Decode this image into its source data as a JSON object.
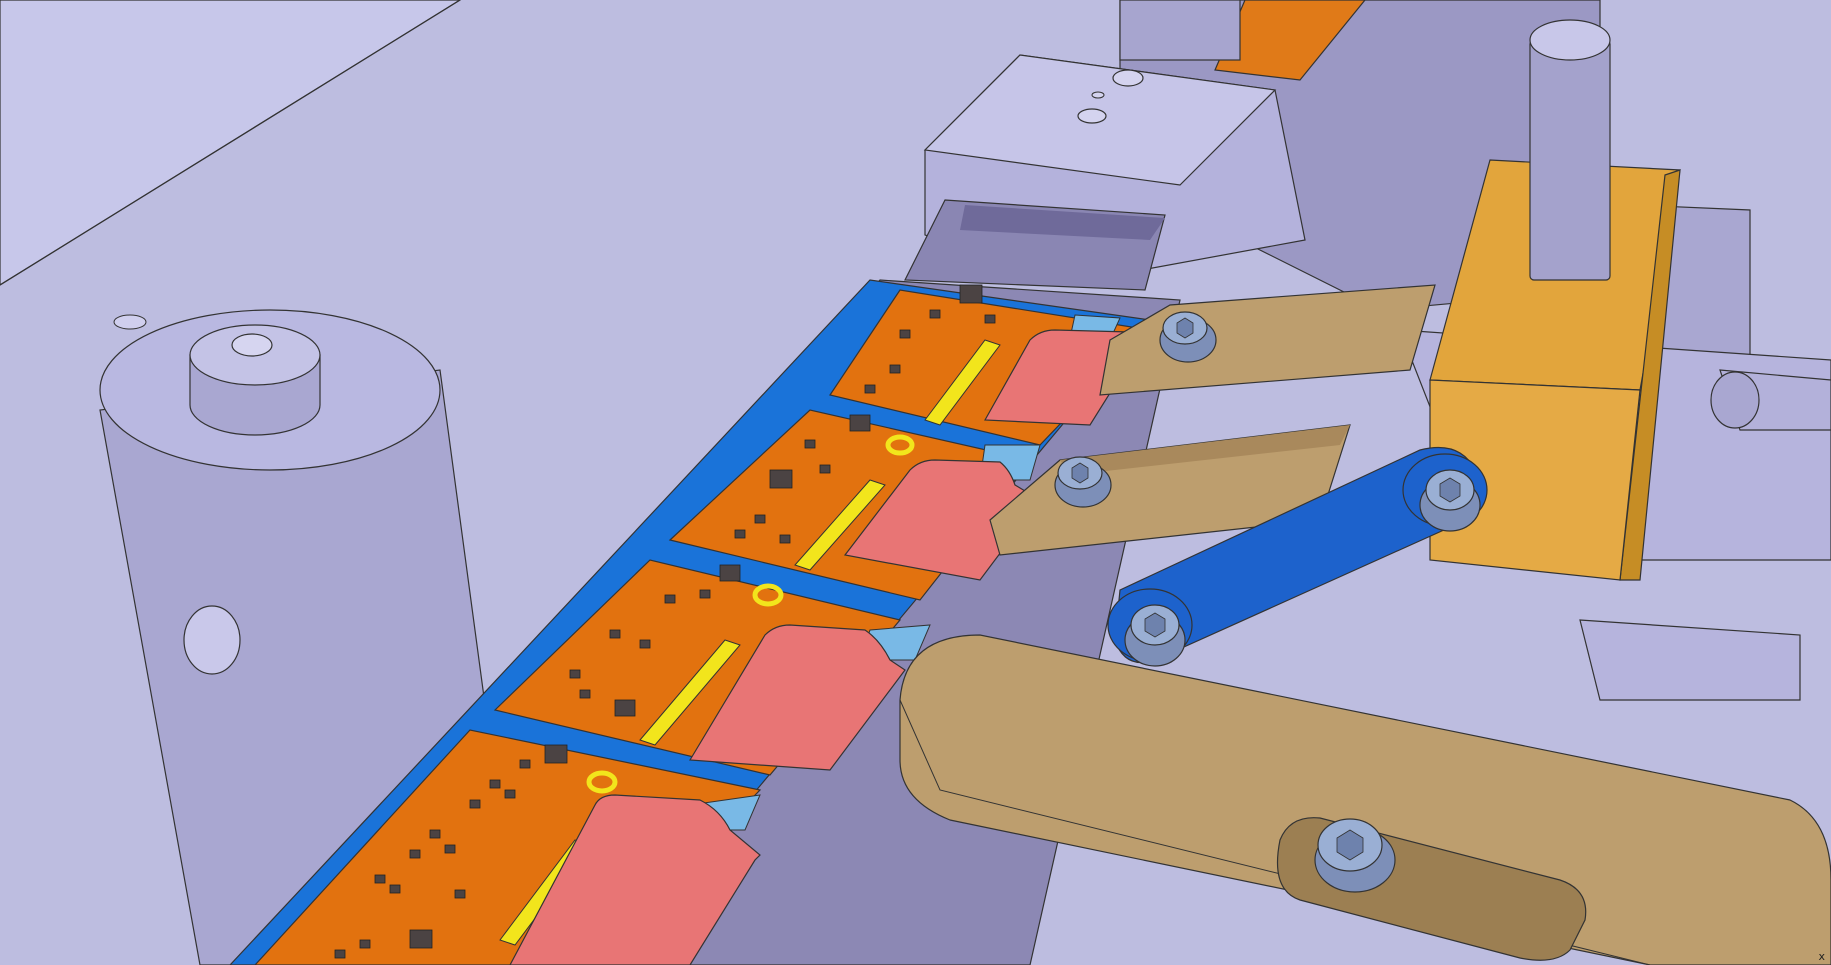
{
  "view": {
    "corner_label": "x",
    "colors": {
      "background": "#bdbde0",
      "base_plate": "#b9b9e1",
      "fixture_metal": "#a6a6cf",
      "fixture_dark": "#8e8ab4",
      "pcb_orange": "#e2720f",
      "pcb_yellow": "#f2e51c",
      "flex_pink": "#e87575",
      "carrier_blue": "#1a73d9",
      "pad_lightblue": "#79b9e6",
      "clamp_tan": "#bd9e6e",
      "block_gold": "#e2a53c",
      "link_blue": "#1d62cc",
      "screw": "#8aa0c8",
      "component_dark": "#4b4343"
    }
  }
}
